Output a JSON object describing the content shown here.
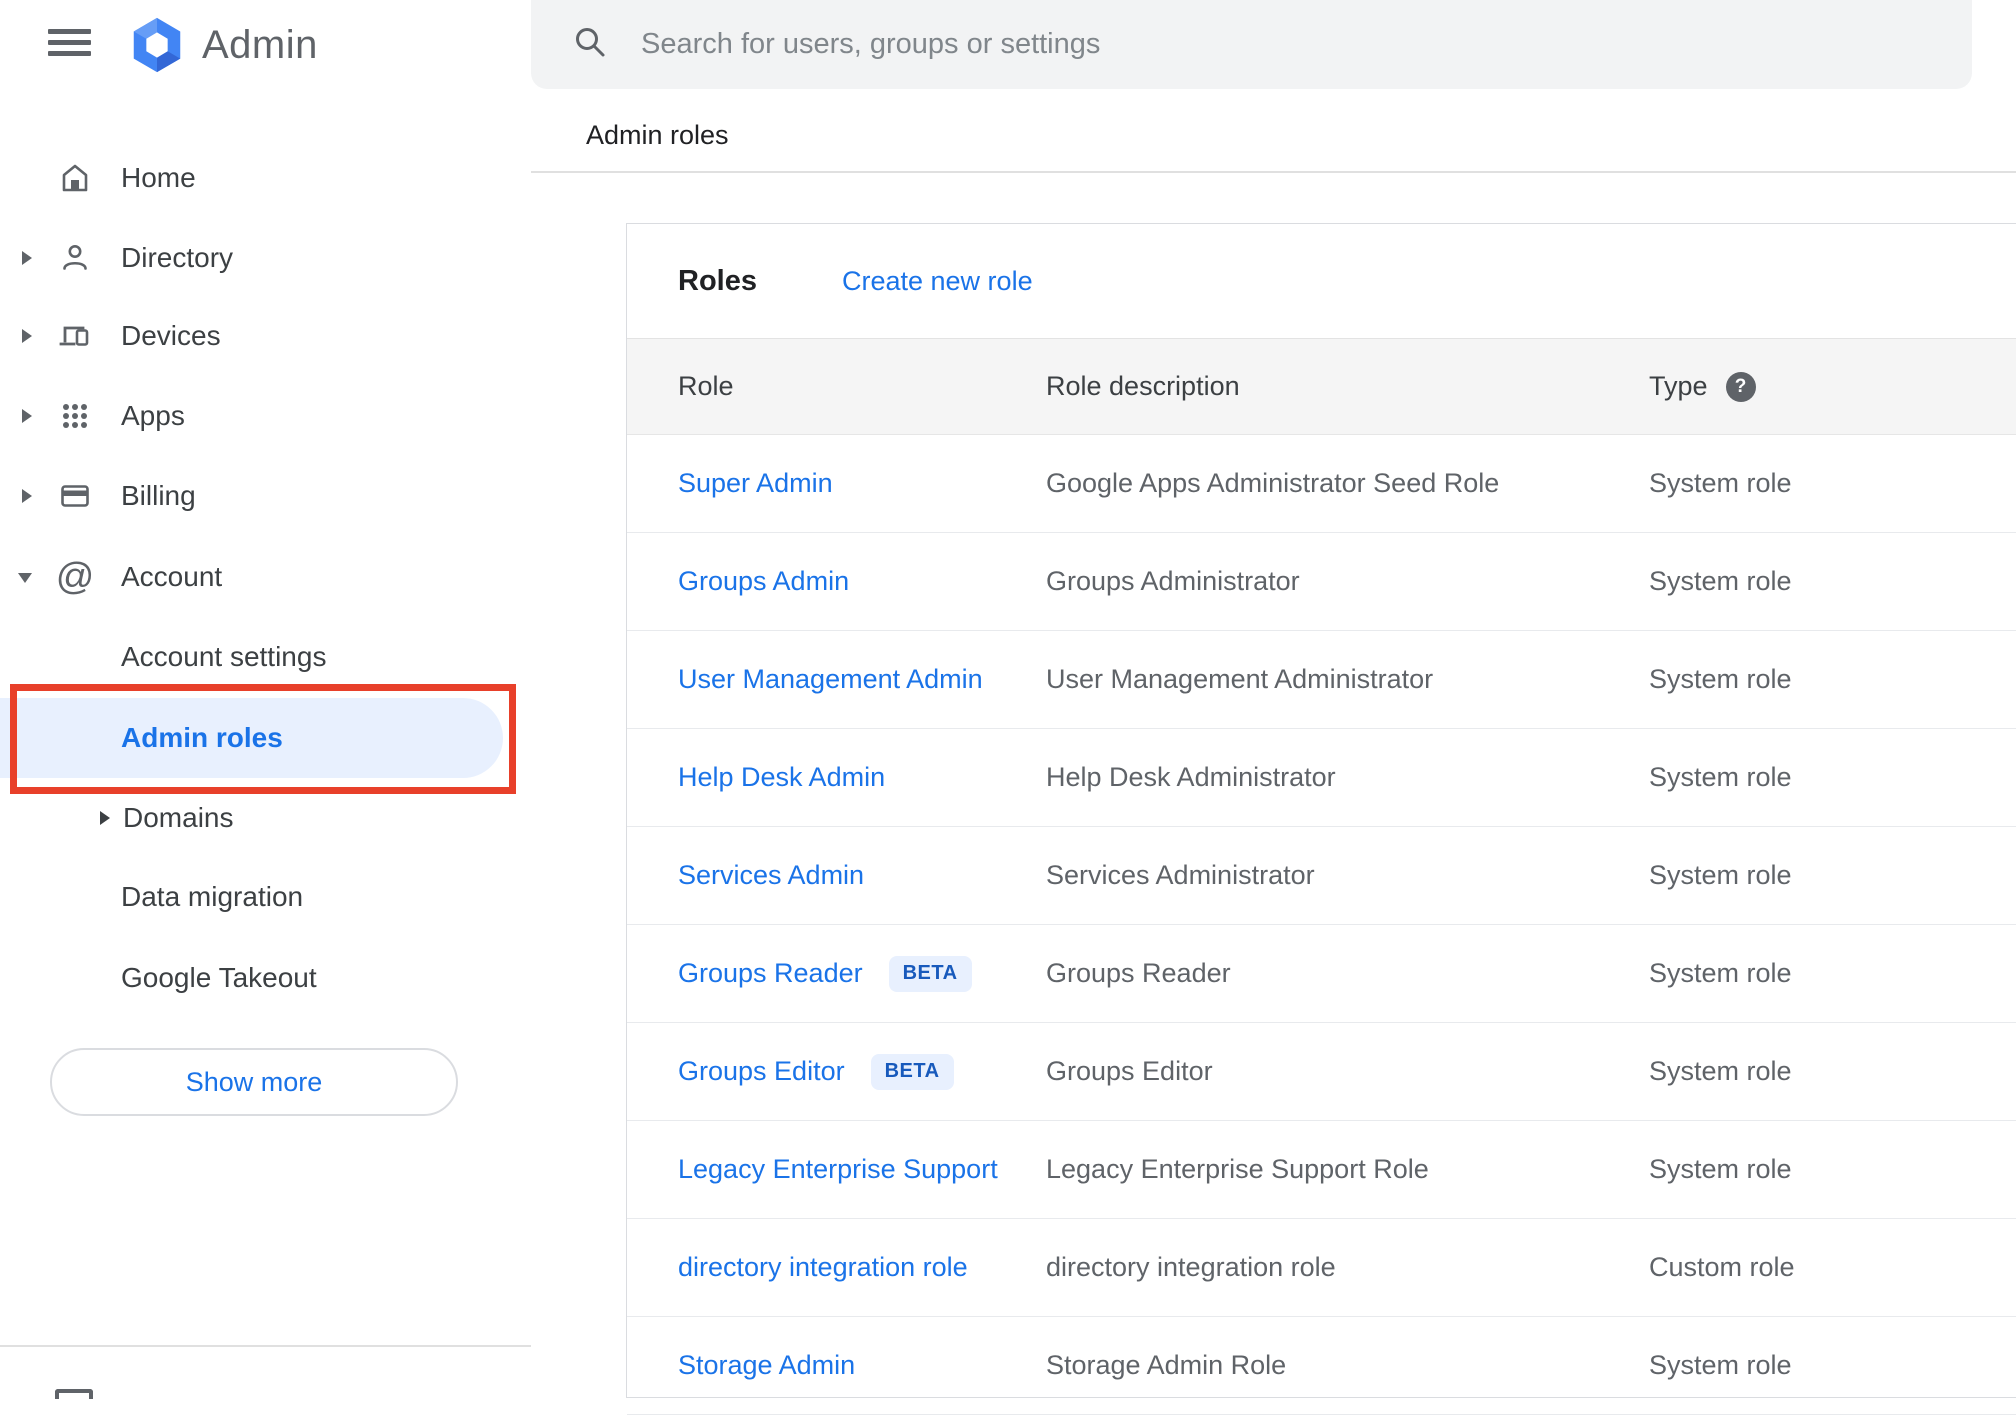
{
  "app": {
    "name": "Admin"
  },
  "search": {
    "placeholder": "Search for users, groups or settings"
  },
  "breadcrumb": "Admin roles",
  "sidebar": {
    "items": [
      {
        "label": "Home"
      },
      {
        "label": "Directory"
      },
      {
        "label": "Devices"
      },
      {
        "label": "Apps"
      },
      {
        "label": "Billing"
      },
      {
        "label": "Account",
        "expanded": true
      },
      {
        "label": "Account settings"
      },
      {
        "label": "Admin roles",
        "selected": true
      },
      {
        "label": "Domains"
      },
      {
        "label": "Data migration"
      },
      {
        "label": "Google Takeout"
      }
    ],
    "show_more_label": "Show more"
  },
  "panel": {
    "title": "Roles",
    "create_link": "Create new role"
  },
  "table": {
    "headers": {
      "role": "Role",
      "description": "Role description",
      "type": "Type"
    },
    "rows": [
      {
        "role": "Super Admin",
        "description": "Google Apps Administrator Seed Role",
        "type": "System role"
      },
      {
        "role": "Groups Admin",
        "description": "Groups Administrator",
        "type": "System role"
      },
      {
        "role": "User Management Admin",
        "description": "User Management Administrator",
        "type": "System role"
      },
      {
        "role": "Help Desk Admin",
        "description": "Help Desk Administrator",
        "type": "System role"
      },
      {
        "role": "Services Admin",
        "description": "Services Administrator",
        "type": "System role"
      },
      {
        "role": "Groups Reader",
        "beta": "BETA",
        "description": "Groups Reader",
        "type": "System role"
      },
      {
        "role": "Groups Editor",
        "beta": "BETA",
        "description": "Groups Editor",
        "type": "System role"
      },
      {
        "role": "Legacy Enterprise Support",
        "description": "Legacy Enterprise Support Role",
        "type": "System role"
      },
      {
        "role": "directory integration role",
        "description": "directory integration role",
        "type": "Custom role"
      },
      {
        "role": "Storage Admin",
        "description": "Storage Admin Role",
        "type": "System role"
      }
    ]
  },
  "colors": {
    "link_blue": "#1a73e8",
    "selected_item_bg": "#e8f0fe",
    "annotation_red": "#e8402a",
    "beta_badge_bg": "#e8f0fe",
    "beta_badge_text": "#185abc",
    "searchbar_bg": "#f2f3f4",
    "table_header_bg": "#f5f5f5"
  }
}
